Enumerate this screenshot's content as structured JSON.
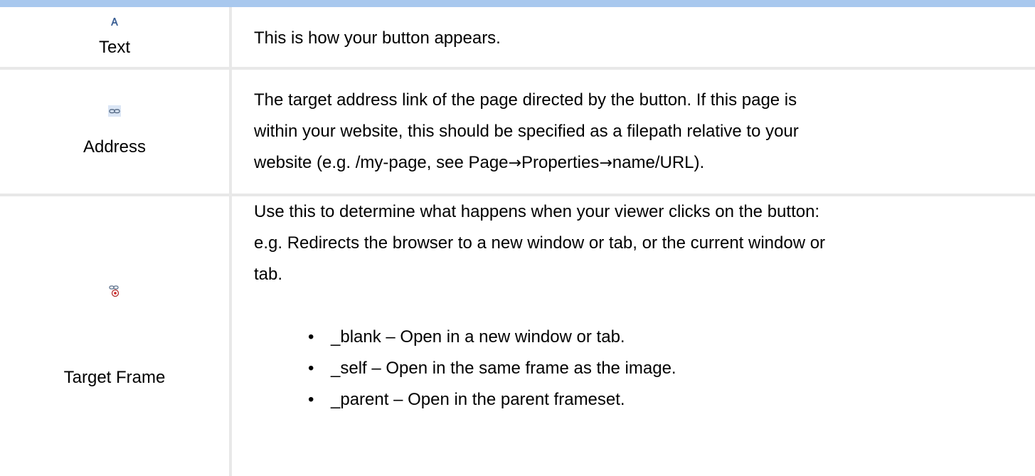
{
  "colors": {
    "top_bar": "#a8c8ee",
    "grid_line": "#e8e8e8"
  },
  "rows": [
    {
      "icon": "text-format-icon",
      "label": "Text",
      "description": "This is how your button appears."
    },
    {
      "icon": "link-icon",
      "label": "Address",
      "description_lines": [
        "The target address link of the page directed by the button.  If this page is",
        "within your website, this should be specified as a filepath relative to your",
        "website (e.g. /my-page, see Page",
        "Properties",
        "name/URL)."
      ],
      "arrow": "→"
    },
    {
      "icon": "target-link-icon",
      "label": "Target Frame",
      "description_lines": [
        "Use this to determine what happens when your viewer clicks on the button:",
        "e.g. Redirects the browser to a new window or tab, or the current window or",
        "tab."
      ],
      "bullet": "•",
      "options": [
        "_blank – Open in a new window or tab.",
        "_self – Open in the same frame as the image.",
        "_parent – Open in the parent frameset."
      ]
    }
  ]
}
